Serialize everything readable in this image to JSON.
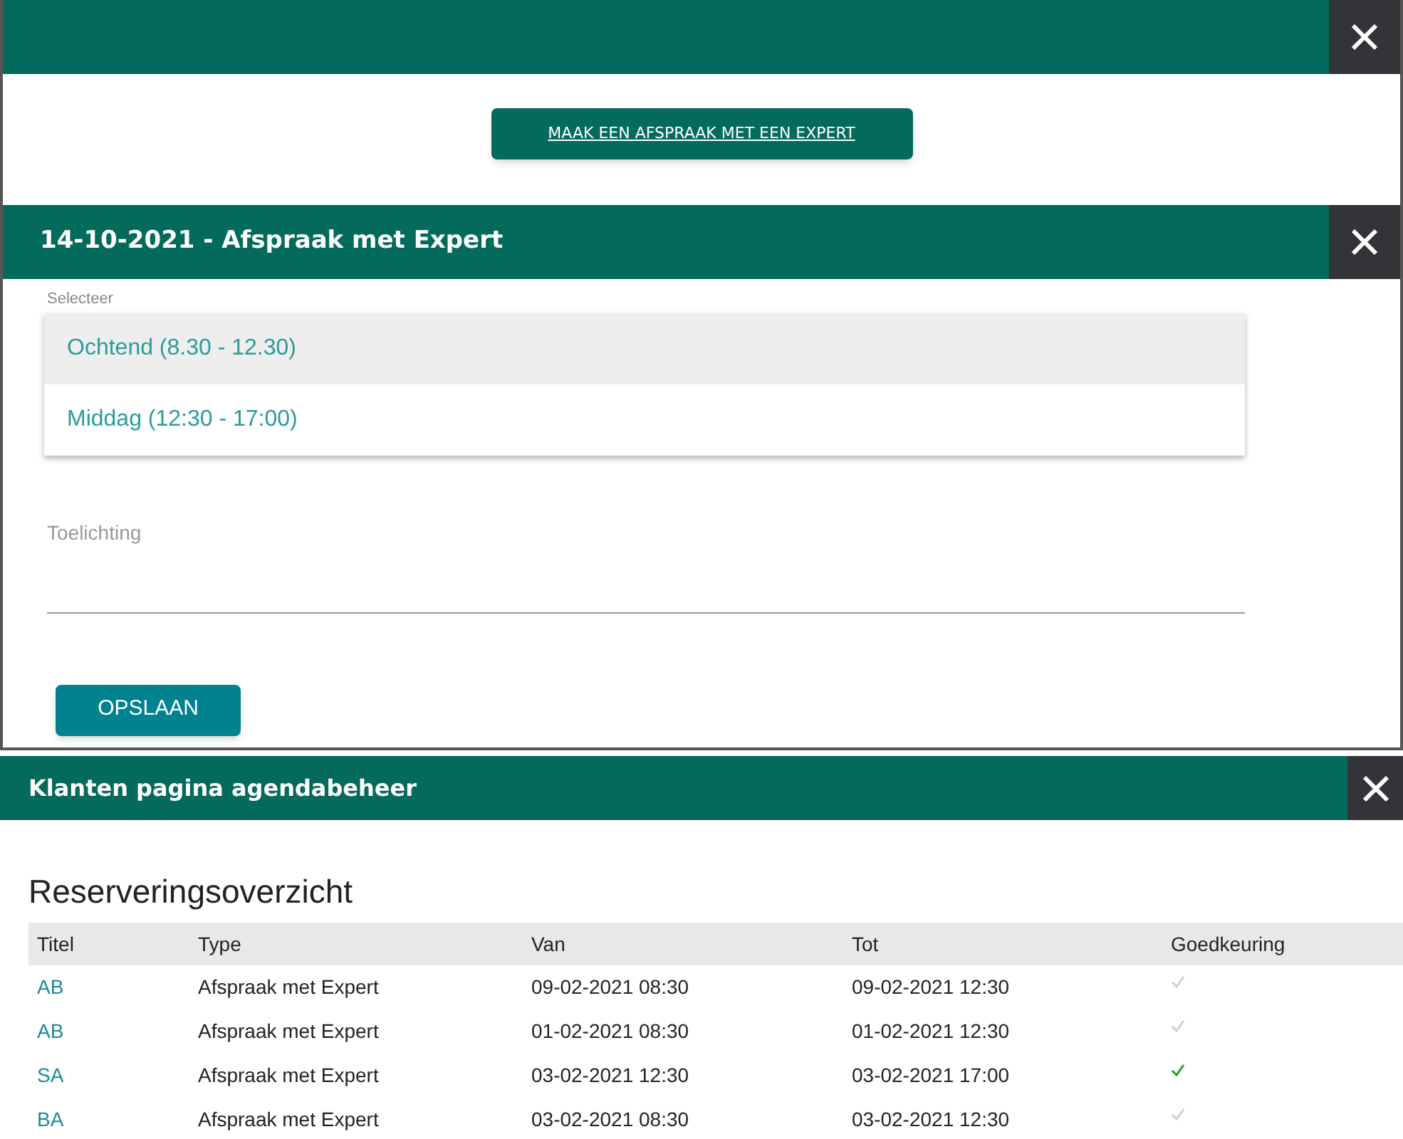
{
  "top_panel": {
    "button": "MAAK EEN AFSPRAAK MET EEN EXPERT"
  },
  "appointment_dialog": {
    "title": "14-10-2021 - Afspraak met Expert",
    "select_label": "Selecteer",
    "options": [
      {
        "label": "Ochtend (8.30 - 12.30)",
        "selected": true
      },
      {
        "label": "Middag (12:30 - 17:00)",
        "selected": false
      }
    ],
    "comment_label": "Toelichting",
    "save_button": "OPSLAAN"
  },
  "agenda_panel": {
    "title": "Klanten pagina agendabeheer",
    "heading": "Reserveringsoverzicht",
    "table": {
      "columns": [
        "Titel",
        "Type",
        "Van",
        "Tot",
        "Goedkeuring"
      ],
      "rows": [
        {
          "title": "AB",
          "type": "Afspraak met Expert",
          "from": "09-02-2021 08:30",
          "to": "09-02-2021 12:30",
          "approved": false
        },
        {
          "title": "AB",
          "type": "Afspraak met Expert",
          "from": "01-02-2021 08:30",
          "to": "01-02-2021 12:30",
          "approved": false
        },
        {
          "title": "SA",
          "type": "Afspraak met Expert",
          "from": "03-02-2021 12:30",
          "to": "03-02-2021 17:00",
          "approved": true
        },
        {
          "title": "BA",
          "type": "Afspraak met Expert",
          "from": "03-02-2021 08:30",
          "to": "03-02-2021 12:30",
          "approved": false
        }
      ]
    }
  }
}
